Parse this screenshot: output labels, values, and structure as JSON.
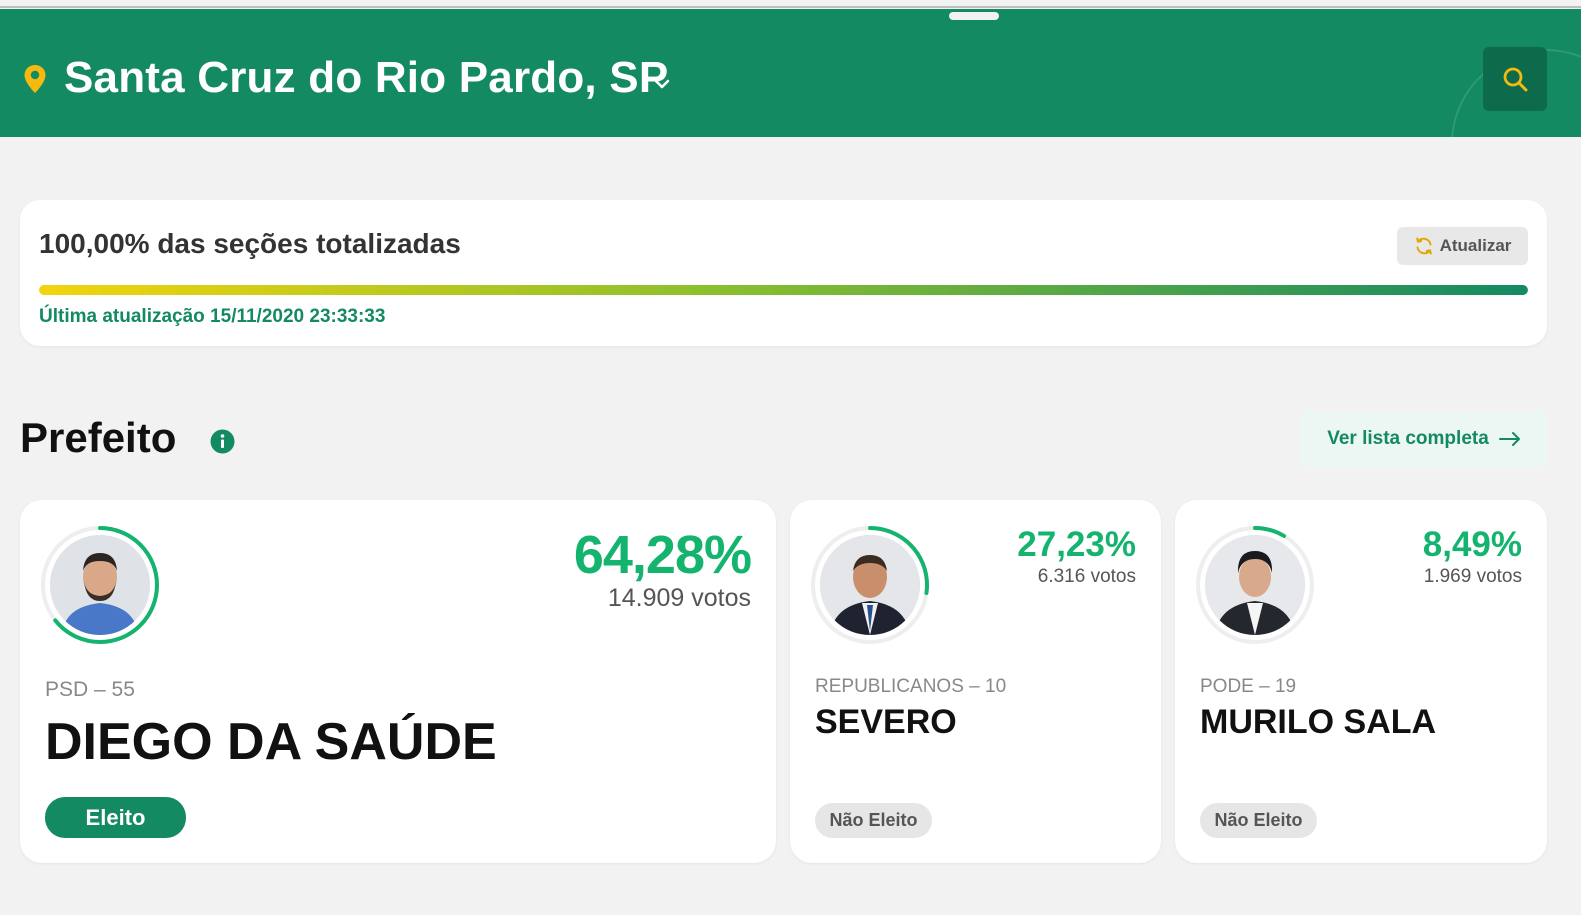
{
  "header": {
    "city": "Santa Cruz do Rio Pardo, SP",
    "icons": {
      "location": "map-pin-icon",
      "dropdown": "chevron-down-icon",
      "search": "search-icon"
    },
    "colors": {
      "brand": "#138a62",
      "pin": "#f5b90f"
    }
  },
  "status": {
    "title": "100,00% das seções totalizadas",
    "progress_percent": 100,
    "refresh_label": "Atualizar",
    "last_update": "Última atualização 15/11/2020 23:33:33"
  },
  "section": {
    "title": "Prefeito",
    "see_all_label": "Ver lista completa"
  },
  "candidates": [
    {
      "name": "DIEGO DA SAÚDE",
      "party": "PSD – 55",
      "percent": "64,28%",
      "votes": "14.909 votos",
      "ring_fraction": 0.6428,
      "status": "Eleito",
      "elected": true
    },
    {
      "name": "SEVERO",
      "party": "REPUBLICANOS – 10",
      "percent": "27,23%",
      "votes": "6.316 votos",
      "ring_fraction": 0.2723,
      "status": "Não Eleito",
      "elected": false
    },
    {
      "name": "MURILO SALA",
      "party": "PODE – 19",
      "percent": "8,49%",
      "votes": "1.969 votos",
      "ring_fraction": 0.0849,
      "status": "Não Eleito",
      "elected": false
    }
  ]
}
